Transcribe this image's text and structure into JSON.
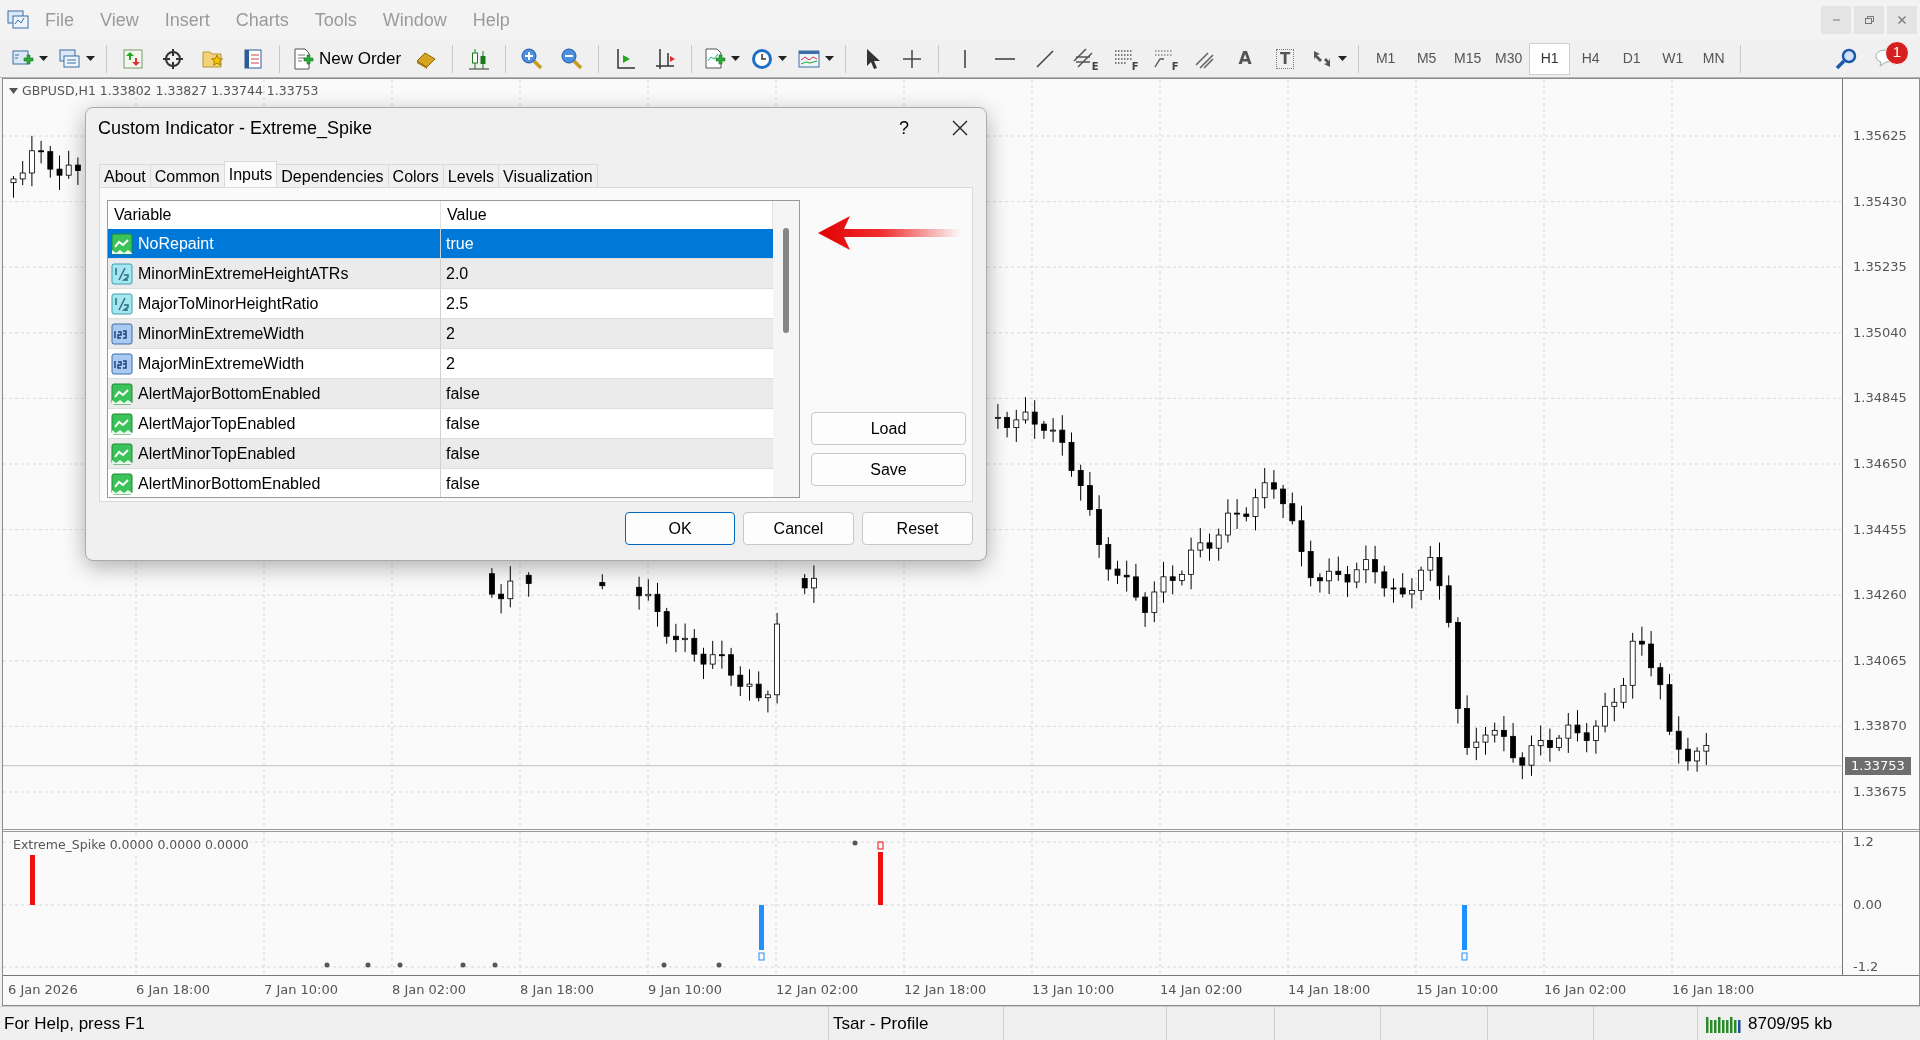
{
  "menu": [
    "File",
    "View",
    "Insert",
    "Charts",
    "Tools",
    "Window",
    "Help"
  ],
  "toolbar": {
    "new_order": "New Order",
    "drawing_tools": [
      {
        "kind": "channel",
        "letter": "E"
      },
      {
        "kind": "fibo",
        "letter": "F"
      },
      {
        "kind": "fan",
        "letter": "F"
      },
      {
        "kind": "parallel"
      },
      {
        "kind": "text",
        "letter": "A"
      },
      {
        "kind": "label",
        "letter": "T"
      }
    ],
    "timeframes": [
      {
        "label": "M1",
        "selected": false
      },
      {
        "label": "M5",
        "selected": false
      },
      {
        "label": "M15",
        "selected": false
      },
      {
        "label": "M30",
        "selected": false
      },
      {
        "label": "H1",
        "selected": true
      },
      {
        "label": "H4",
        "selected": false
      },
      {
        "label": "D1",
        "selected": false
      },
      {
        "label": "W1",
        "selected": false
      },
      {
        "label": "MN",
        "selected": false
      }
    ],
    "notifications": "1"
  },
  "chart": {
    "symbol": "GBPUSD,H1",
    "ohlc": "1.33802 1.33827 1.33744 1.33753",
    "price_labels": [
      "1.35625",
      "1.35430",
      "1.35235",
      "1.35040",
      "1.34845",
      "1.34650",
      "1.34455",
      "1.34260",
      "1.34065",
      "1.33870",
      "1.33675"
    ],
    "current_price": "1.33753"
  },
  "indicator": {
    "title": "Extreme_Spike 0.0000 0.0000 0.0000",
    "scale_labels": [
      "1.2",
      "0.00",
      "-1.2"
    ]
  },
  "time_labels": [
    "6 Jan 2026",
    "6 Jan 18:00",
    "7 Jan 10:00",
    "8 Jan 02:00",
    "8 Jan 18:00",
    "9 Jan 10:00",
    "12 Jan 02:00",
    "12 Jan 18:00",
    "13 Jan 10:00",
    "14 Jan 02:00",
    "14 Jan 18:00",
    "15 Jan 10:00",
    "16 Jan 02:00",
    "16 Jan 18:00"
  ],
  "dialog": {
    "title": "Custom Indicator - Extreme_Spike",
    "help": "?",
    "tabs": [
      {
        "label": "About",
        "selected": false
      },
      {
        "label": "Common",
        "selected": false
      },
      {
        "label": "Inputs",
        "selected": true
      },
      {
        "label": "Dependencies",
        "selected": false
      },
      {
        "label": "Colors",
        "selected": false
      },
      {
        "label": "Levels",
        "selected": false
      },
      {
        "label": "Visualization",
        "selected": false
      }
    ],
    "columns": [
      "Variable",
      "Value"
    ],
    "rows": [
      {
        "kind": "bool",
        "variable": "NoRepaint",
        "value": "true",
        "selected": true
      },
      {
        "kind": "double",
        "variable": "MinorMinExtremeHeightATRs",
        "value": "2.0",
        "selected": false
      },
      {
        "kind": "double",
        "variable": "MajorToMinorHeightRatio",
        "value": "2.5",
        "selected": false
      },
      {
        "kind": "int",
        "variable": "MinorMinExtremeWidth",
        "value": "2",
        "selected": false
      },
      {
        "kind": "int",
        "variable": "MajorMinExtremeWidth",
        "value": "2",
        "selected": false
      },
      {
        "kind": "bool",
        "variable": "AlertMajorBottomEnabled",
        "value": "false",
        "selected": false
      },
      {
        "kind": "bool",
        "variable": "AlertMajorTopEnabled",
        "value": "false",
        "selected": false
      },
      {
        "kind": "bool",
        "variable": "AlertMinorTopEnabled",
        "value": "false",
        "selected": false
      },
      {
        "kind": "bool",
        "variable": "AlertMinorBottomEnabled",
        "value": "false",
        "selected": false
      }
    ],
    "side_buttons": [
      "Load",
      "Save"
    ],
    "buttons": [
      {
        "label": "OK",
        "default": true
      },
      {
        "label": "Cancel",
        "default": false
      },
      {
        "label": "Reset",
        "default": false
      }
    ]
  },
  "status_bar": {
    "help": "For Help, press F1",
    "profile": "Tsar - Profile",
    "traffic": "8709/95 kb"
  }
}
